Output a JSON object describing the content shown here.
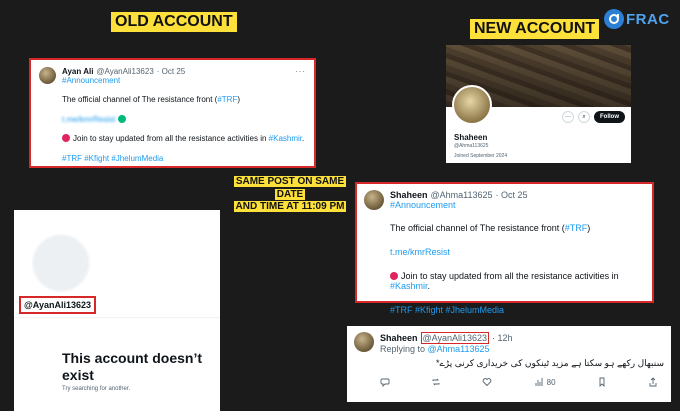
{
  "headers": {
    "old": "OLD ACCOUNT",
    "new": "NEW ACCOUNT"
  },
  "logo": {
    "text": "FRAC"
  },
  "caption": {
    "line1": "SAME POST ON SAME DATE",
    "line2": "AND TIME AT 11:09 PM"
  },
  "old_tweet": {
    "name": "Ayan Ali",
    "handle": "@AyanAli13623",
    "date": "· Oct 25",
    "tag": "#Announcement",
    "text_pre": "The official channel of The resistance front (",
    "text_tag": "#TRF",
    "text_post": ")",
    "link": "t.me/kmrResist",
    "join_pre": "Join to stay updated from all the resistance activities in ",
    "join_tag": "#Kashmir",
    "join_post": ".",
    "hashtags": "#TRF #Kfight #JhelumMedia"
  },
  "new_tweet": {
    "name": "Shaheen",
    "handle": "@Ahma113625",
    "date": "· Oct 25",
    "tag": "#Announcement",
    "text_pre": "The official channel of The resistance front (",
    "text_tag": "#TRF",
    "text_post": ")",
    "link": "t.me/kmrResist",
    "join_pre": "Join to stay updated from all the resistance activities in ",
    "join_tag": "#Kashmir",
    "join_post": ".",
    "hashtags": "#TRF #Kfight #JhelumMedia"
  },
  "new_profile": {
    "name": "Shaheen",
    "handle": "@Ahma113625",
    "joined": "Joined September 2024",
    "follow_label": "Follow"
  },
  "old_profile": {
    "handle": "@AyanAli13623",
    "title": "This account doesn’t exist",
    "subtitle": "Try searching for another."
  },
  "reply": {
    "name": "Shaheen",
    "handle": "@AyanAli13623",
    "time": "· 12h",
    "replying_prefix": "Replying to ",
    "replying_handle": "@Ahma113625",
    "text": "سنبھال رکھے ہو سکتا ہے مزید ٹینکوں کی خریداری کرنی پڑے*",
    "views": "80"
  }
}
